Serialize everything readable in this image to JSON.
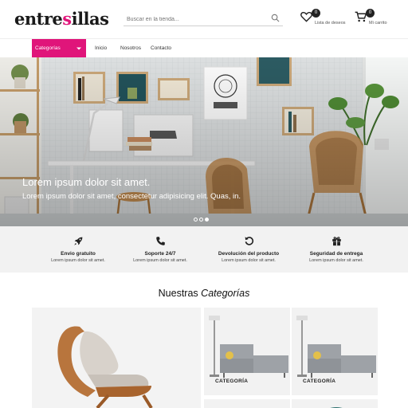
{
  "brand": {
    "logo_part1": "entre",
    "logo_part2": "sillas",
    "accent_color": "#e0157a"
  },
  "search": {
    "placeholder": "Buscar en la tienda..."
  },
  "header_actions": {
    "wishlist": {
      "icon": "heart-icon",
      "count": "0",
      "label": "Lista de deseos"
    },
    "cart": {
      "icon": "cart-icon",
      "count": "0",
      "label": "Mi carrito"
    }
  },
  "nav": {
    "categories_label": "Categorías",
    "links": [
      "Inicio",
      "Nosotros",
      "Contacto"
    ]
  },
  "hero": {
    "title": "Lorem ipsum dolor sit amet.",
    "subtitle": "Lorem ipsum dolor sit amet, consectetur adipisicing elit. Quas, in.",
    "slides": 3,
    "active_slide": 3
  },
  "features": [
    {
      "icon": "rocket-icon",
      "title": "Envio gratuito",
      "subtitle": "Lorem ipsum dolor sit amet."
    },
    {
      "icon": "phone-icon",
      "title": "Soporte 24/7",
      "subtitle": "Lorem ipsum dolor sit amet."
    },
    {
      "icon": "return-icon",
      "title": "Devolución del producto",
      "subtitle": "Lorem ipsum dolor sit amet."
    },
    {
      "icon": "gift-icon",
      "title": "Seguridad de entrega",
      "subtitle": "Lorem ipsum dolor sit amet."
    }
  ],
  "categories": {
    "heading_plain": "Nuestras",
    "heading_italic": "Categorías",
    "cards": [
      {
        "label": ""
      },
      {
        "label": "CATEGORÍA"
      },
      {
        "label": "CATEGORÍA"
      }
    ]
  }
}
